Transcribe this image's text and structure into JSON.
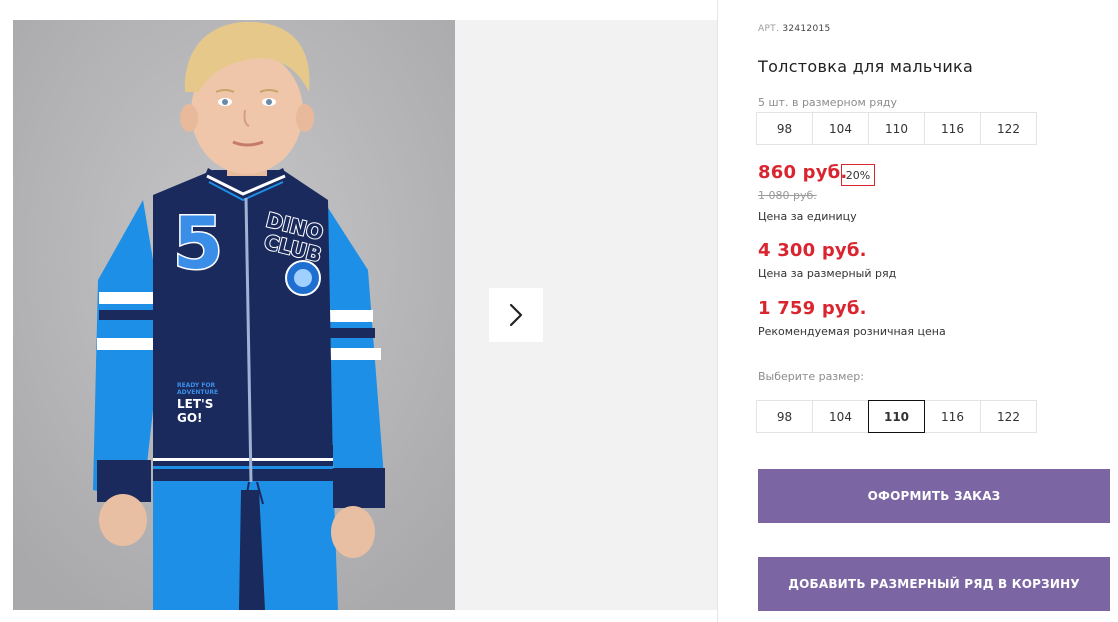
{
  "product": {
    "article_label": "АРТ.",
    "article_number": "32412015",
    "title": "Толстовка для мальчика",
    "pack_hint": "5 шт. в размерном ряду",
    "pack_sizes": [
      "98",
      "104",
      "110",
      "116",
      "122"
    ],
    "price": "860 руб.",
    "discount": "20%",
    "old_price": "1 080 руб.",
    "price_caption": "Цена за единицу",
    "pack_price": "4 300 руб.",
    "pack_price_caption": "Цена за размерный ряд",
    "retail_price": "1 759 руб.",
    "retail_price_caption": "Рекомендуемая розничная цена",
    "select_size_label": "Выберите размер:",
    "size_options": [
      "98",
      "104",
      "110",
      "116",
      "122"
    ],
    "selected_size": "110"
  },
  "actions": {
    "checkout_label": "ОФОРМИТЬ ЗАКАЗ",
    "add_pack_label": "ДОБАВИТЬ РАЗМЕРНЫЙ РЯД В КОРЗИНУ"
  },
  "gallery": {
    "next_icon": "chevron-right-icon",
    "photo_text": {
      "number": "5",
      "patch_line1": "DINO",
      "patch_line2": "CLUB",
      "print_small1": "READY FOR",
      "print_small2": "ADVENTURE",
      "print_big1": "LET'S",
      "print_big2": "GO!"
    }
  },
  "colors": {
    "accent": "#7b66a3",
    "price_red": "#d9252f",
    "jacket_navy": "#1b2a5c",
    "sleeve_blue": "#1e8fe6"
  }
}
